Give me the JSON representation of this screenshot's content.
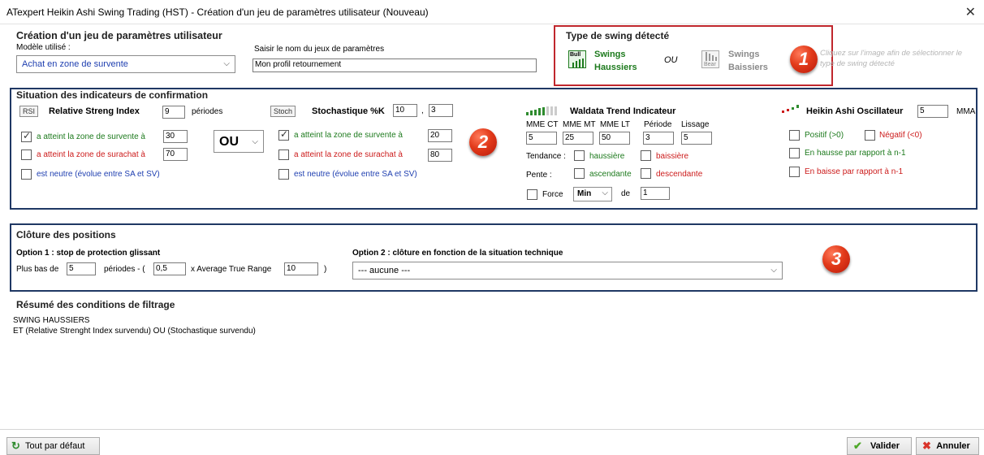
{
  "window": {
    "title": "ATexpert Heikin Ashi Swing Trading (HST) - Création d'un jeu de paramètres utilisateur (Nouveau)",
    "close_icon": "close-icon"
  },
  "header": {
    "section_title": "Création d'un jeu de paramètres utilisateur",
    "model_label": "Modèle utilisé :",
    "model_value": "Achat en zone de survente",
    "name_label": "Saisir le nom du jeux de paramètres",
    "name_value": "Mon profil retournement"
  },
  "swing": {
    "title": "Type de swing détecté",
    "bull_icon_text": "Bull",
    "bull_label_1": "Swings",
    "bull_label_2": "Haussiers",
    "or_label": "OU",
    "bear_icon_text": "Bear",
    "bear_label_1": "Swings",
    "bear_label_2": "Baissiers",
    "hint_1": "Cliquez sur l'image afin de sélectionner le",
    "hint_2": "type de swing détecté",
    "badge": "1"
  },
  "indicators": {
    "title": "Situation des indicateurs de confirmation",
    "badge": "2",
    "rsi": {
      "tag": "RSI",
      "name": "Relative Streng Index",
      "periods_value": "9",
      "periods_label": "périodes",
      "oversold_label": "a atteint la zone de survente à",
      "oversold_value": "30",
      "oversold_checked": true,
      "overbought_label": "a atteint la zone de surachat à",
      "overbought_value": "70",
      "overbought_checked": false,
      "neutral_label": "est neutre (évolue entre SA et SV)",
      "neutral_checked": false
    },
    "operator": "OU",
    "stoch": {
      "tag": "Stoch",
      "name": "Stochastique %K",
      "k_value": "10",
      "sep": ",",
      "d_value": "3",
      "oversold_label": "a atteint la zone de survente à",
      "oversold_value": "20",
      "oversold_checked": true,
      "overbought_label": "a atteint la zone de surachat à",
      "overbought_value": "80",
      "overbought_checked": false,
      "neutral_label": "est neutre (évolue entre SA et SV)",
      "neutral_checked": false
    },
    "waldata": {
      "name": "Waldata Trend Indicateur",
      "col_labels": [
        "MME CT",
        "MME MT",
        "MME LT",
        "Période",
        "Lissage"
      ],
      "values": [
        "5",
        "25",
        "50",
        "3",
        "5"
      ],
      "trend_label": "Tendance :",
      "up_label": "haussière",
      "down_label": "baissière",
      "slope_label": "Pente :",
      "asc_label": "ascendante",
      "desc_label": "descendante",
      "force_label": "Force",
      "force_select": "Min",
      "de_label": "de",
      "force_value": "1"
    },
    "heikin": {
      "name": "Heikin Ashi Oscillateur",
      "value": "5",
      "unit": "MMA",
      "pos_label": "Positif (>0)",
      "neg_label": "Négatif (<0)",
      "rise_label": "En hausse par rapport à n-1",
      "fall_label": "En baisse par rapport à n-1"
    }
  },
  "closing": {
    "title": "Clôture des positions",
    "badge": "3",
    "opt1_title": "Option 1 : stop de protection glissant",
    "low_label": "Plus bas de",
    "low_value": "5",
    "periods_label": "périodes - (",
    "mult_value": "0,5",
    "atr_label": "x Average True Range",
    "atr_value": "10",
    "close_paren": ")",
    "opt2_title": "Option 2 : clôture en fonction de la situation technique",
    "opt2_value": "--- aucune ---"
  },
  "summary": {
    "title": "Résumé des conditions de filtrage",
    "line1": "SWING HAUSSIERS",
    "line2": "ET  (Relative Strenght Index survendu) OU (Stochastique survendu)"
  },
  "footer": {
    "default_button": "Tout par défaut",
    "validate_button": "Valider",
    "cancel_button": "Annuler"
  },
  "colors": {
    "green": "#1d7a1d",
    "red": "#cc1b1b",
    "blue": "#1f3fb0",
    "frame": "#1f3864",
    "highlight": "#c0272d"
  }
}
